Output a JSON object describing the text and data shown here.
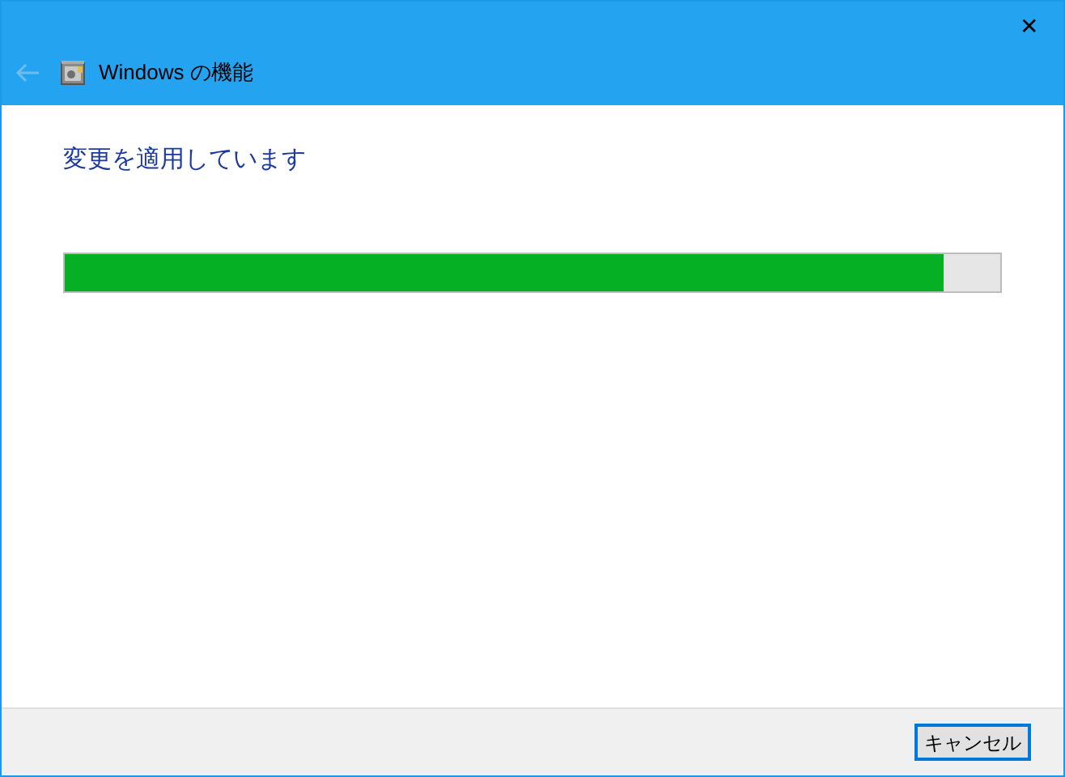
{
  "window": {
    "title": "Windows の機能",
    "close": "✕"
  },
  "back_button": {
    "disabled": true
  },
  "heading": "変更を適用しています",
  "progress": {
    "level": 0.94
  },
  "buttons": [
    {
      "label": "キャンセル",
      "focused": true
    }
  ]
}
